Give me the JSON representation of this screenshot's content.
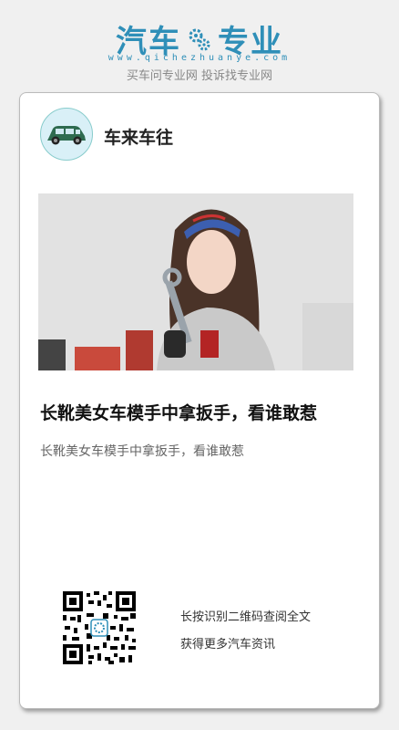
{
  "header": {
    "logo_left": "汽车",
    "logo_right": "专业",
    "domain": "www.qichezhuanye.com",
    "slogan": "买车问专业网 投诉找专业网"
  },
  "post": {
    "author": "车来车往",
    "title": "长靴美女车模手中拿扳手，看谁敢惹",
    "description": "长靴美女车模手中拿扳手，看谁敢惹"
  },
  "qr": {
    "line1": "长按识别二维码查阅全文",
    "line2": "获得更多汽车资讯"
  },
  "colors": {
    "brand": "#2f8fb8",
    "card_bg": "#ffffff",
    "page_bg": "#f0f0f0"
  }
}
